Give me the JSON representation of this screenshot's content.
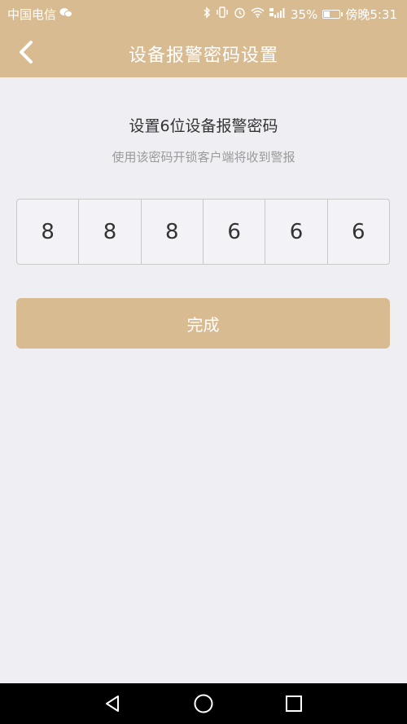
{
  "status_bar": {
    "carrier": "中国电信",
    "battery_percent": "35%",
    "time": "傍晚5:31",
    "battery_level": 0.35,
    "icons": [
      "wechat-icon",
      "bluetooth-icon",
      "vibrate-icon",
      "alarm-icon",
      "wifi-icon",
      "signal-icon",
      "battery-icon"
    ]
  },
  "nav": {
    "title": "设备报警密码设置",
    "back_icon": "chevron-left-icon"
  },
  "main": {
    "heading": "设置6位设备报警密码",
    "subheading": "使用该密码开锁客户端将收到警报",
    "code_digits": [
      "8",
      "8",
      "8",
      "6",
      "6",
      "6"
    ],
    "done_label": "完成"
  },
  "system_nav": {
    "buttons": [
      "back-triangle-icon",
      "home-circle-icon",
      "recents-square-icon"
    ]
  },
  "colors": {
    "accent": "#d9bb92",
    "background": "#efeef3",
    "text_primary": "#333333",
    "text_secondary": "#9a9a9a"
  }
}
